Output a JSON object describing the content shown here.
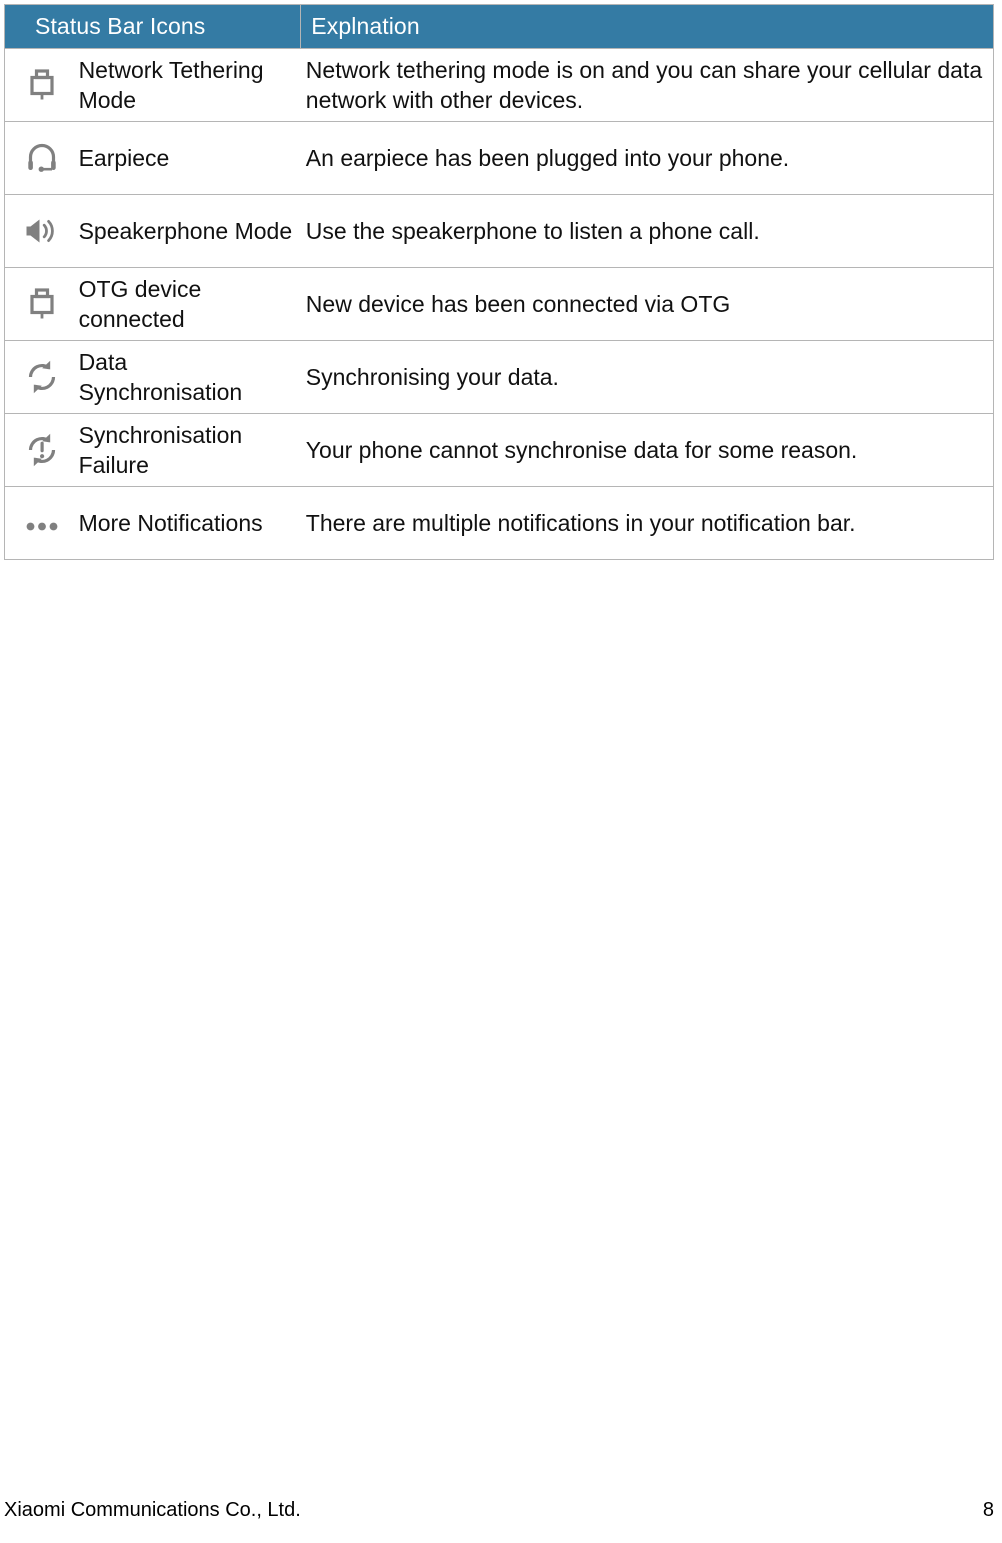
{
  "table": {
    "columns": {
      "icon": "",
      "name": "Status Bar Icons",
      "explanation": "Explnation"
    },
    "rows": [
      {
        "icon": "usb-tethering-plug-icon",
        "name": "Network Tethering Mode",
        "explanation": "Network tethering mode is on and you can share your cellular data network with other devices."
      },
      {
        "icon": "headset-earpiece-icon",
        "name": "Earpiece",
        "explanation": "An earpiece has been plugged into your phone."
      },
      {
        "icon": "speaker-volume-icon",
        "name": "Speakerphone Mode",
        "explanation": "Use the speakerphone to listen a phone call."
      },
      {
        "icon": "usb-otg-plug-icon",
        "name": "OTG device connected",
        "explanation": "New device has been connected via OTG"
      },
      {
        "icon": "sync-arrows-icon",
        "name": "Data Synchronisation",
        "explanation": "Synchronising your data."
      },
      {
        "icon": "sync-error-icon",
        "name": "Synchronisation Failure",
        "explanation": "Your phone cannot synchronise data for some reason."
      },
      {
        "icon": "more-dots-icon",
        "name": "More Notifications",
        "explanation": "There are multiple notifications in your notification bar."
      }
    ]
  },
  "footer": {
    "company": "Xiaomi Communications Co., Ltd.",
    "page_number": "8"
  },
  "colors": {
    "header_background": "#347ba4",
    "header_text": "#ffffff",
    "border": "#b5b5b5",
    "icon": "#808080",
    "body_text": "#111111"
  }
}
